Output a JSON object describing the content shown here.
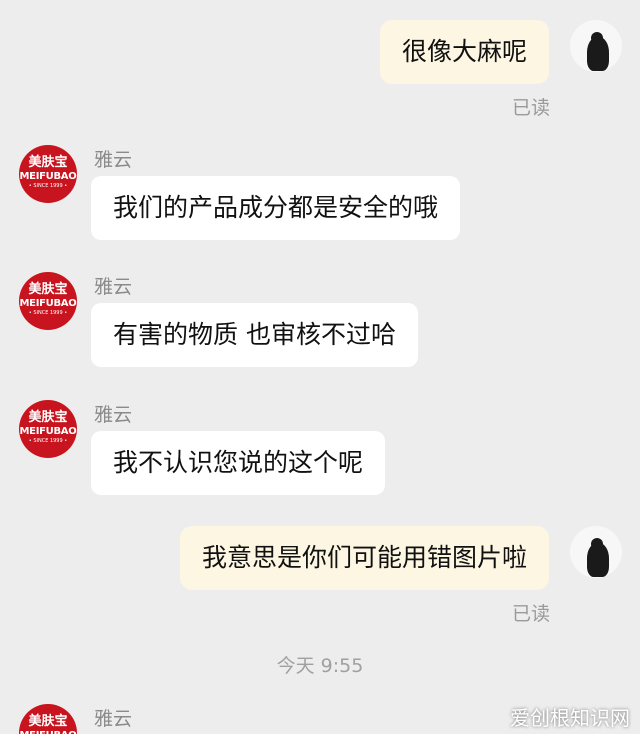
{
  "colors": {
    "background": "#ededed",
    "bubble_self": "#fdf6e3",
    "bubble_other": "#ffffff",
    "brand_red": "#c8141f"
  },
  "brand_avatar": {
    "cn": "美肤宝",
    "en": "MEIFUBAO",
    "since": "• SINCE 1999 •"
  },
  "messages": [
    {
      "side": "self",
      "text": "很像大麻呢",
      "status": "已读"
    },
    {
      "side": "other",
      "sender": "雅云",
      "text": "我们的产品成分都是安全的哦"
    },
    {
      "side": "other",
      "sender": "雅云",
      "text": "有害的物质 也审核不过哈"
    },
    {
      "side": "other",
      "sender": "雅云",
      "text": "我不认识您说的这个呢"
    },
    {
      "side": "self",
      "text": "我意思是你们可能用错图片啦",
      "status": "已读"
    },
    {
      "side": "time",
      "text": "今天 9:55"
    },
    {
      "side": "other",
      "sender": "雅云",
      "text": ""
    }
  ],
  "watermark": "爱创根知识网"
}
